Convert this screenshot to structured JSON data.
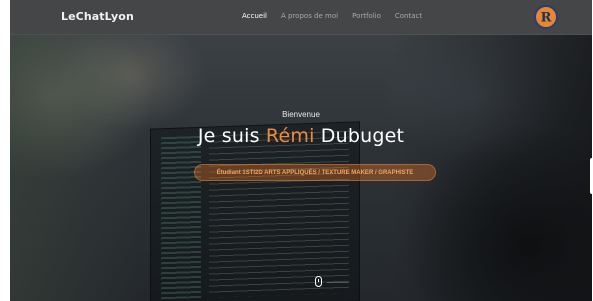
{
  "header": {
    "brand": "LeChatLyon",
    "nav": [
      "Accueil",
      "A propos de moi",
      "Portfolio",
      "Contact"
    ],
    "active_nav": "Accueil",
    "logo_letter": "R"
  },
  "hero": {
    "welcome": "Bienvenue",
    "headline_prefix": "Je suis ",
    "headline_name_accent": "Rémi",
    "headline_suffix": " Dubuget",
    "tagline": "Étudiant 1STI2D ARTS APPLIQUÉS / TEXTURE MAKER / GRAPHISTE"
  },
  "icons": {
    "scroll": "mouse-scroll-icon",
    "logo": "monogram-logo-icon"
  },
  "colors": {
    "accent": "#f08a3a",
    "header_bg": "#46484a",
    "logo_ring": "#2a3b7a",
    "logo_fill": "#e9882a"
  }
}
